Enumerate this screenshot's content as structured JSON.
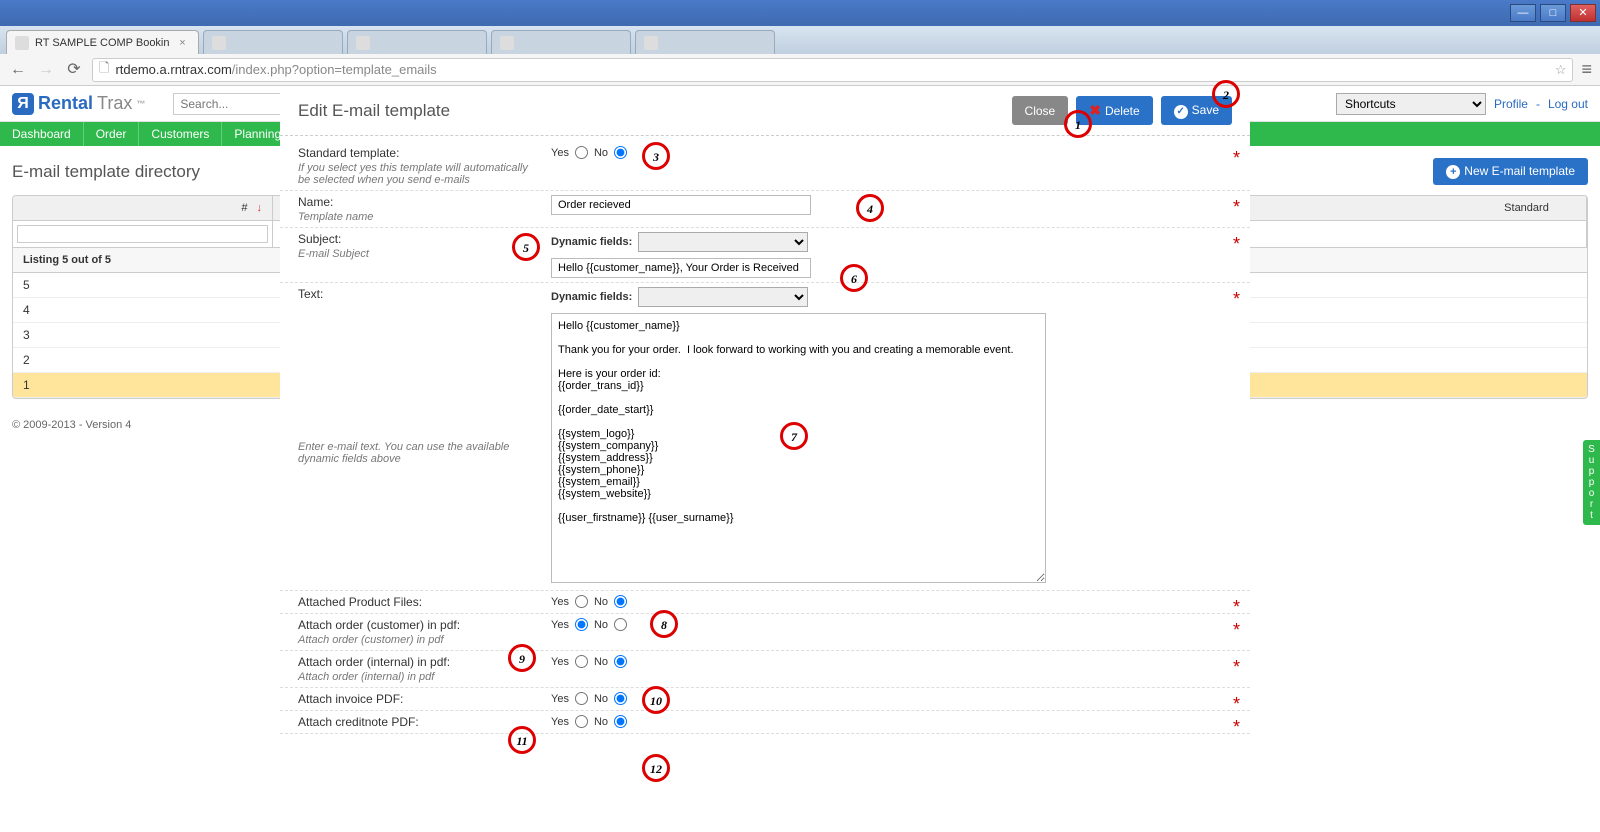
{
  "browser": {
    "tab_title": "RT SAMPLE COMP Bookin",
    "url_host": "rtdemo.a.rntrax.com",
    "url_path": "/index.php?option=template_emails"
  },
  "logo": {
    "brand1": "Rental",
    "brand2": "Trax"
  },
  "search_placeholder": "Search...",
  "shortcuts_label": "Shortcuts",
  "profile_link": "Profile",
  "logout_link": "Log out",
  "nav": [
    "Dashboard",
    "Order",
    "Customers",
    "Planning"
  ],
  "page_title": "E-mail template directory",
  "btn_new_template": "New E-mail template",
  "dir_col_sort": "#",
  "dir_col_std": "Standard",
  "dir_listing": "Listing 5 out of 5",
  "dir_rows": [
    "5",
    "4",
    "3",
    "2",
    "1"
  ],
  "footer": "© 2009-2013 - Version 4",
  "modal": {
    "title": "Edit E-mail template",
    "btn_close": "Close",
    "btn_delete": "Delete",
    "btn_save": "Save",
    "rows": {
      "standard": {
        "label": "Standard template:",
        "hint": "If you select yes this template will automatically be selected when you send e-mails",
        "yes": "Yes",
        "no": "No",
        "value": "no"
      },
      "name": {
        "label": "Name:",
        "hint": "Template name",
        "value": "Order recieved"
      },
      "subject": {
        "label": "Subject:",
        "hint": "E-mail Subject",
        "dyn_label": "Dynamic fields:",
        "value": "Hello {{customer_name}}, Your Order is Received"
      },
      "text": {
        "label": "Text:",
        "hint": "Enter e-mail text. You can use the available dynamic fields above",
        "dyn_label": "Dynamic fields:",
        "value": "Hello {{customer_name}}\n\nThank you for your order.  I look forward to working with you and creating a memorable event.\n\nHere is your order id:\n{{order_trans_id}}\n\n{{order_date_start}}\n\n{{system_logo}}\n{{system_company}}\n{{system_address}}\n{{system_phone}}\n{{system_email}}\n{{system_website}}\n\n{{user_firstname}} {{user_surname}}"
      },
      "attached_prod": {
        "label": "Attached Product Files:",
        "yes": "Yes",
        "no": "No",
        "value": "no"
      },
      "attach_cust": {
        "label": "Attach order (customer) in pdf:",
        "hint": "Attach order (customer) in pdf",
        "yes": "Yes",
        "no": "No",
        "value": "yes"
      },
      "attach_int": {
        "label": "Attach order (internal) in pdf:",
        "hint": "Attach order (internal) in pdf",
        "yes": "Yes",
        "no": "No",
        "value": "no"
      },
      "attach_inv": {
        "label": "Attach invoice PDF:",
        "yes": "Yes",
        "no": "No",
        "value": "no"
      },
      "attach_cred": {
        "label": "Attach creditnote PDF:",
        "yes": "Yes",
        "no": "No",
        "value": "no"
      }
    }
  },
  "support_tab": "Support",
  "anno": {
    "1": "1",
    "2": "2",
    "3": "3",
    "4": "4",
    "5": "5",
    "6": "6",
    "7": "7",
    "8": "8",
    "9": "9",
    "10": "10",
    "11": "11",
    "12": "12"
  }
}
